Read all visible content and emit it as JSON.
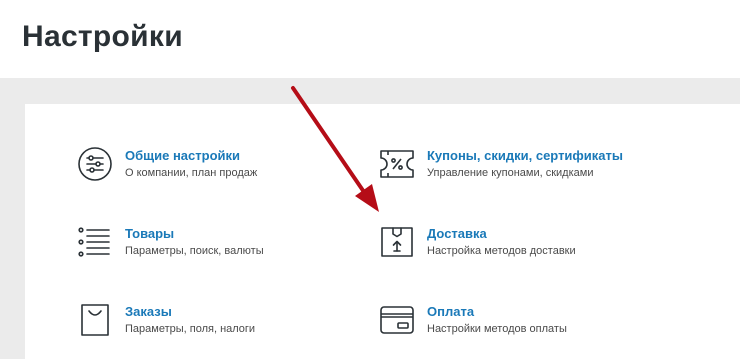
{
  "page": {
    "title": "Настройки"
  },
  "settings": {
    "general": {
      "title": "Общие настройки",
      "desc": "О компании, план продаж",
      "icon": "sliders-icon"
    },
    "coupons": {
      "title": "Купоны, скидки, сертификаты",
      "desc": "Управление купонами, скидками",
      "icon": "coupon-icon"
    },
    "products": {
      "title": "Товары",
      "desc": "Параметры, поиск, валюты",
      "icon": "list-icon"
    },
    "delivery": {
      "title": "Доставка",
      "desc": "Настройка методов доставки",
      "icon": "package-icon"
    },
    "orders": {
      "title": "Заказы",
      "desc": "Параметры, поля, налоги",
      "icon": "shopping-bag-icon"
    },
    "payment": {
      "title": "Оплата",
      "desc": "Настройки методов оплаты",
      "icon": "credit-card-icon"
    }
  },
  "colors": {
    "link": "#1a79b8",
    "title": "#2a3136",
    "annotation_arrow": "#b50d17",
    "background": "#ebebeb"
  }
}
